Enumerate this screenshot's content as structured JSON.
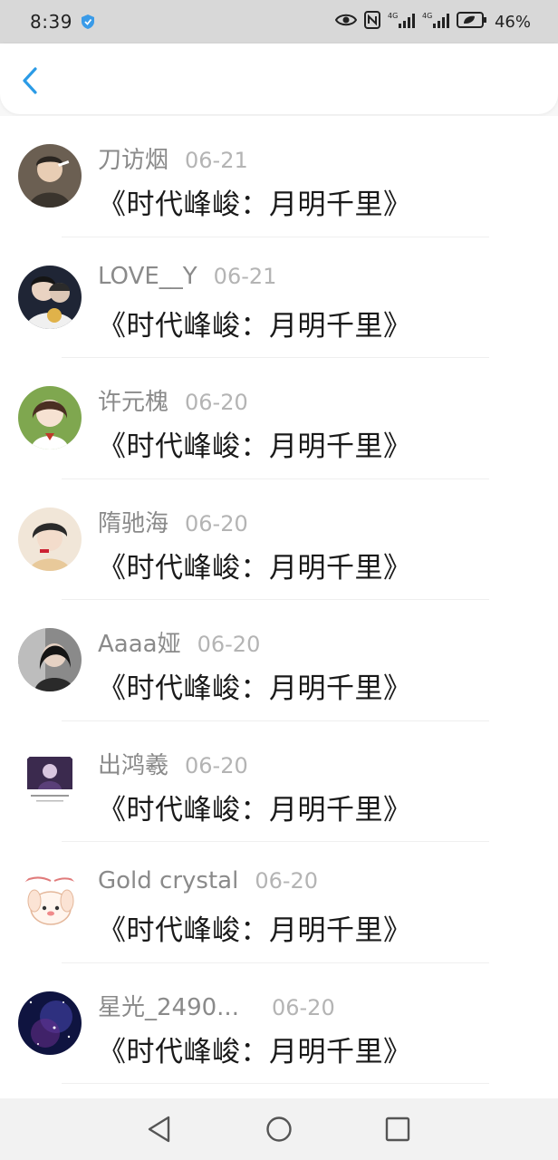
{
  "status_bar": {
    "time": "8:39",
    "battery": "46%",
    "network_1": "4G",
    "network_2": "4G"
  },
  "header": {
    "back_icon": "chevron-left-icon",
    "accent_color": "#2b9be6"
  },
  "items": [
    {
      "username": "刀访烟",
      "date": "06-21",
      "title": "《时代峰峻：月明千里》"
    },
    {
      "username": "LOVE__Y",
      "date": "06-21",
      "title": "《时代峰峻：月明千里》"
    },
    {
      "username": "许元槐",
      "date": "06-20",
      "title": "《时代峰峻：月明千里》"
    },
    {
      "username": "隋驰海",
      "date": "06-20",
      "title": "《时代峰峻：月明千里》"
    },
    {
      "username": "Aaaa娅",
      "date": "06-20",
      "title": "《时代峰峻：月明千里》"
    },
    {
      "username": "出鸿羲",
      "date": "06-20",
      "title": "《时代峰峻：月明千里》"
    },
    {
      "username": "Gold crystal",
      "date": "06-20",
      "title": "《时代峰峻：月明千里》"
    },
    {
      "username": "星光_2490...",
      "date": "06-20",
      "title": "《时代峰峻：月明千里》"
    }
  ],
  "nav": {
    "back": "triangle-back-icon",
    "home": "circle-home-icon",
    "recents": "square-recents-icon"
  }
}
